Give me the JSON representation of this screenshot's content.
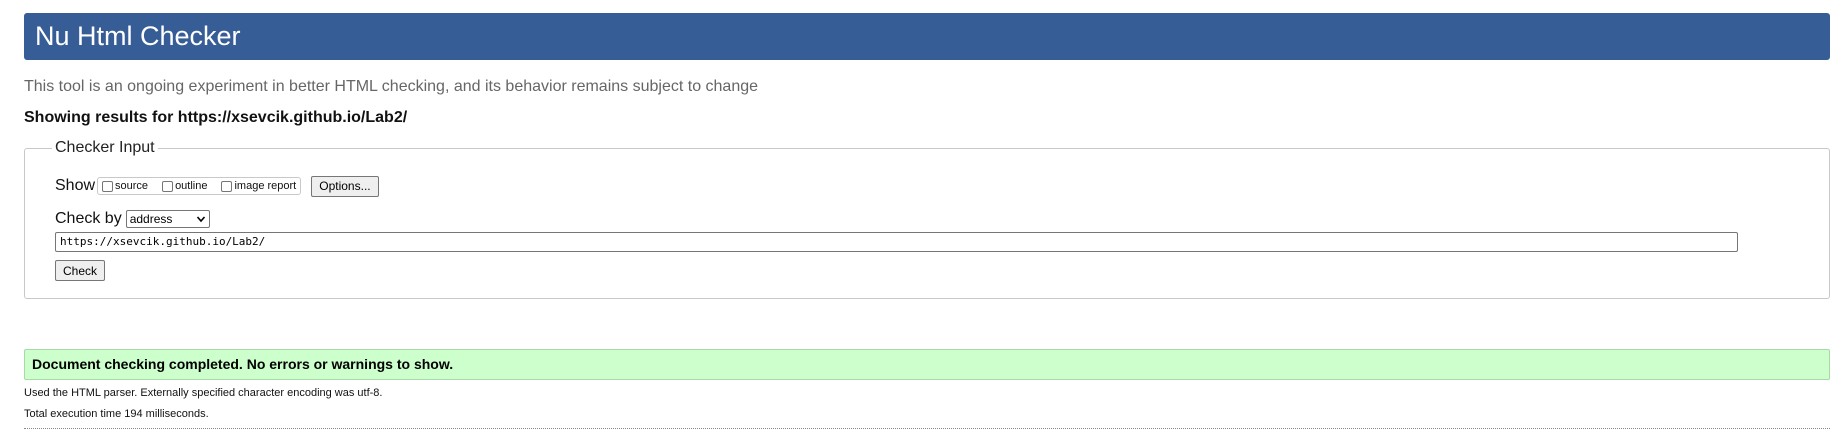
{
  "header": {
    "title": "Nu Html Checker"
  },
  "intro": {
    "text": "This tool is an ongoing experiment in better HTML checking, and its behavior remains subject to change"
  },
  "showing": {
    "text": "Showing results for https://xsevcik.github.io/Lab2/"
  },
  "checker_input": {
    "legend": "Checker Input",
    "show_label": "Show",
    "options": [
      {
        "label": "source",
        "checked": false
      },
      {
        "label": "outline",
        "checked": false
      },
      {
        "label": "image report",
        "checked": false
      }
    ],
    "options_button": "Options...",
    "check_by_label": "Check by",
    "check_by_value": "address",
    "url_value": "https://xsevcik.github.io/Lab2/",
    "check_button": "Check"
  },
  "results": {
    "status": "Document checking completed. No errors or warnings to show.",
    "parser_info": "Used the HTML parser. Externally specified character encoding was utf-8.",
    "execution_time": "Total execution time 194 milliseconds."
  },
  "colors": {
    "header_bg": "#365d95",
    "success_bg": "#ccffcc"
  },
  "icons": {
    "select_arrow": "chevron-down-icon"
  }
}
